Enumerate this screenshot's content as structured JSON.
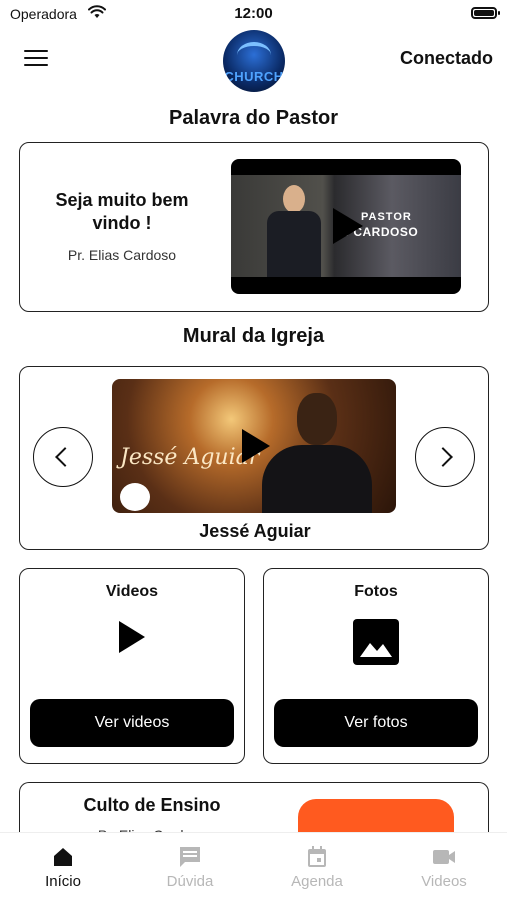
{
  "status_bar": {
    "carrier": "Operadora",
    "time": "12:00"
  },
  "header": {
    "logo_text": "CHURCH",
    "connect_label": "Conectado"
  },
  "pastor_section": {
    "title": "Palavra do Pastor",
    "headline": "Seja muito bem vindo !",
    "author": "Pr. Elias Cardoso",
    "video_overlay_line1": "PASTOR",
    "video_overlay_line2": "S CARDOSO"
  },
  "mural_section": {
    "title": "Mural da Igreja",
    "image_signature": "Jessé Aguiar",
    "caption": "Jessé Aguiar"
  },
  "tiles": {
    "videos": {
      "title": "Videos",
      "button": "Ver videos",
      "icon": "play-icon"
    },
    "fotos": {
      "title": "Fotos",
      "button": "Ver fotos",
      "icon": "image-icon"
    }
  },
  "culto": {
    "title": "Culto de Ensino",
    "subtitle": "Pr. Elias Cardoso"
  },
  "tabbar": {
    "tabs": [
      {
        "label": "Início",
        "icon": "home-icon",
        "active": true
      },
      {
        "label": "Dúvida",
        "icon": "chat-icon",
        "active": false
      },
      {
        "label": "Agenda",
        "icon": "calendar-icon",
        "active": false
      },
      {
        "label": "Videos",
        "icon": "videocam-icon",
        "active": false
      }
    ]
  },
  "colors": {
    "accent": "#000000",
    "inactive_tab": "#b7b7b7",
    "youtube": "#ff5a1f"
  }
}
